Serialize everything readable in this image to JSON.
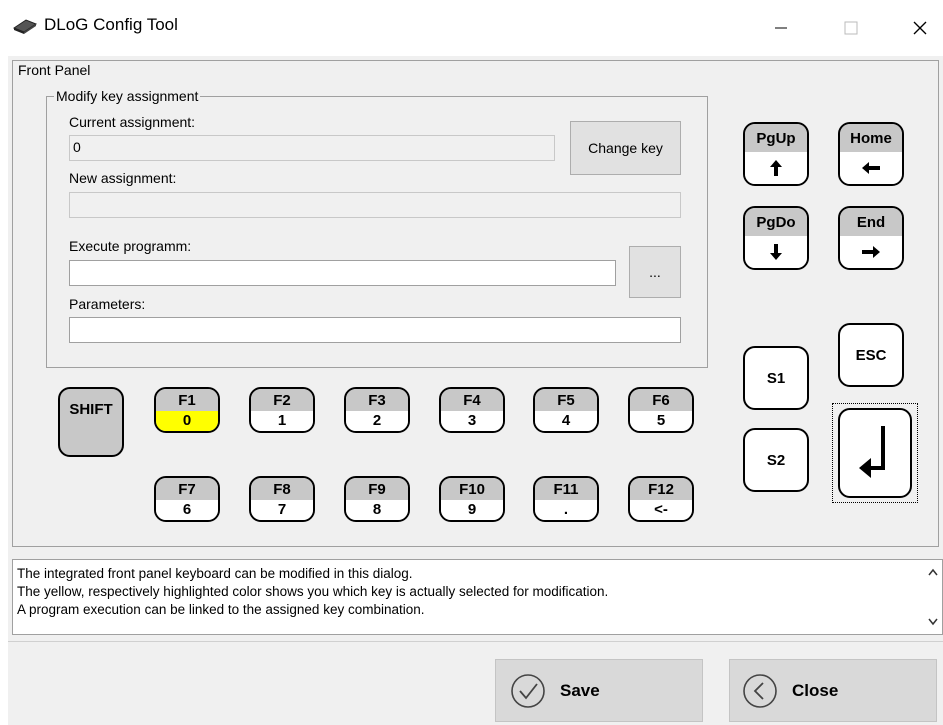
{
  "window": {
    "title": "DLoG Config Tool",
    "icon": "keyboard-icon",
    "controls": [
      "minimize-icon",
      "maximize-icon",
      "close-icon"
    ]
  },
  "front_panel": {
    "group_label": "Front Panel",
    "modify": {
      "group_label": "Modify key assignment",
      "current_assignment_label": "Current assignment:",
      "current_assignment_value": "0",
      "change_key_button": "Change key",
      "new_assignment_label": "New assignment:",
      "new_assignment_value": "",
      "execute_label": "Execute programm:",
      "execute_value": "",
      "browse_button": "...",
      "parameters_label": "Parameters:",
      "parameters_value": ""
    },
    "shift_key": "SHIFT",
    "function_keys_row1": [
      {
        "top": "F1",
        "bottom": "0",
        "selected": true
      },
      {
        "top": "F2",
        "bottom": "1"
      },
      {
        "top": "F3",
        "bottom": "2"
      },
      {
        "top": "F4",
        "bottom": "3"
      },
      {
        "top": "F5",
        "bottom": "4"
      },
      {
        "top": "F6",
        "bottom": "5"
      }
    ],
    "function_keys_row2": [
      {
        "top": "F7",
        "bottom": "6"
      },
      {
        "top": "F8",
        "bottom": "7"
      },
      {
        "top": "F9",
        "bottom": "8"
      },
      {
        "top": "F10",
        "bottom": "9"
      },
      {
        "top": "F11",
        "bottom": "."
      },
      {
        "top": "F12",
        "bottom": "<-"
      }
    ],
    "nav_keys": [
      {
        "top": "PgUp",
        "icon": "arrow-up-icon"
      },
      {
        "top": "Home",
        "icon": "arrow-left-icon"
      },
      {
        "top": "PgDo",
        "icon": "arrow-down-icon"
      },
      {
        "top": "End",
        "icon": "arrow-right-icon"
      }
    ],
    "s1_key": "S1",
    "s2_key": "S2",
    "esc_key": "ESC",
    "enter_key_icon": "enter-icon",
    "selected_color": "#ffff00"
  },
  "info": {
    "line1": "The integrated front panel keyboard can be modified in this dialog.",
    "line2": "The yellow, respectively highlighted color shows you which key is actually selected for modification.",
    "line3": "A program execution can be linked to the assigned key combination."
  },
  "footer": {
    "save_label": "Save",
    "close_label": "Close"
  }
}
